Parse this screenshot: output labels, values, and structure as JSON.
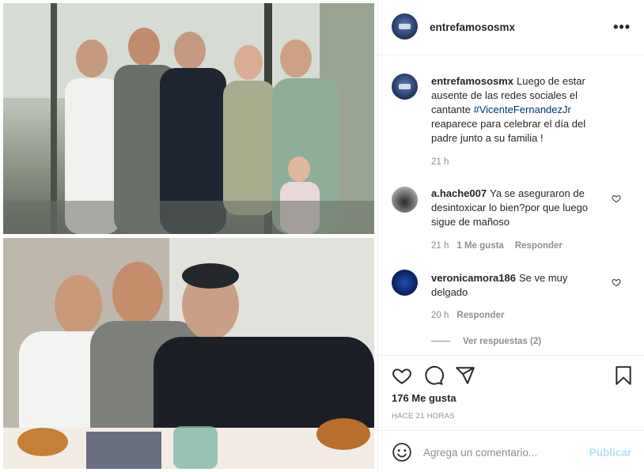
{
  "account": {
    "username": "entrefamososmx"
  },
  "header": {
    "more_label": "•••"
  },
  "caption": {
    "username": "entrefamososmx",
    "text_before": "Luego de estar ausente de las redes sociales el cantante ",
    "hashtag": "#VicenteFernandezJr",
    "text_after": " reaparece para celebrar el día del padre junto a su familia !",
    "time": "21 h"
  },
  "comments": [
    {
      "username": "a.hache007",
      "text": "Ya se aseguraron de desintoxicar lo bien?por que luego sigue de mañoso",
      "time": "21 h",
      "likes": "1 Me gusta",
      "reply": "Responder"
    },
    {
      "username": "veronicamora186",
      "text": "Se ve muy delgado",
      "time": "20 h",
      "reply": "Responder",
      "view_replies": "Ver respuestas (2)"
    }
  ],
  "actions": {
    "icons": [
      "heart-icon",
      "comment-icon",
      "share-icon",
      "bookmark-icon"
    ],
    "likes_label": "176 Me gusta",
    "posted_ago": "HACE 21 HORAS"
  },
  "add_comment": {
    "placeholder": "Agrega un comentario...",
    "publish_label": "Publicar"
  },
  "colors": {
    "link": "#00376b",
    "publish_disabled": "#b2dffc",
    "muted": "#8e8e8e"
  }
}
